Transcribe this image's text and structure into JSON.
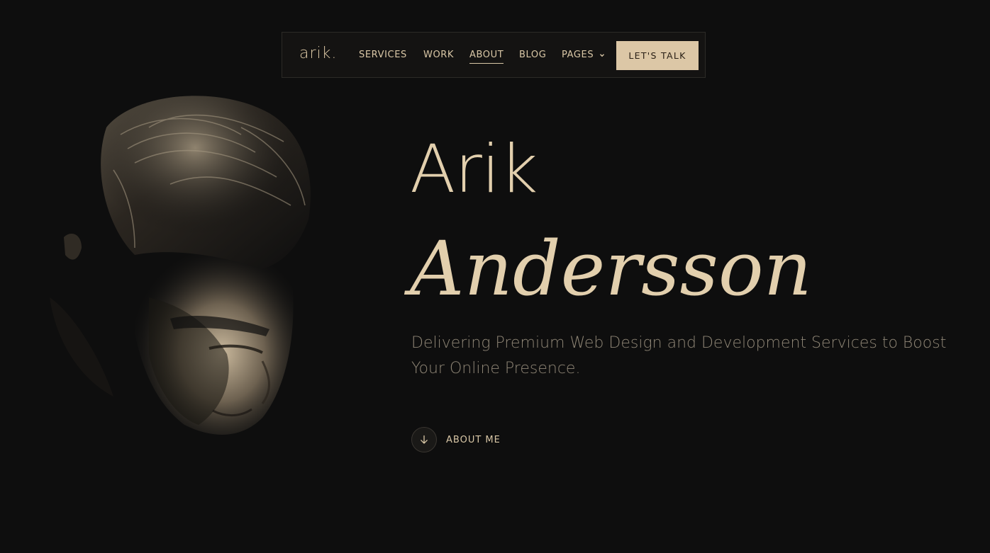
{
  "nav": {
    "logo": "arik.",
    "items": [
      {
        "label": "SERVICES"
      },
      {
        "label": "WORK"
      },
      {
        "label": "ABOUT",
        "active": true
      },
      {
        "label": "BLOG"
      },
      {
        "label": "PAGES",
        "has_dropdown": true
      }
    ],
    "cta_label": "LET'S TALK"
  },
  "hero": {
    "first_name": "Arik",
    "last_name": "Andersson",
    "tagline": "Delivering Premium Web Design and Development Services to Boost Your Online Presence.",
    "about_label": "ABOUT ME",
    "about_icon": "arrow-down-icon"
  },
  "portrait": {
    "icon": "portrait-photo"
  },
  "colors": {
    "background": "#0e0e0e",
    "accent": "#dcc7a6",
    "muted_text": "#8f8676"
  }
}
